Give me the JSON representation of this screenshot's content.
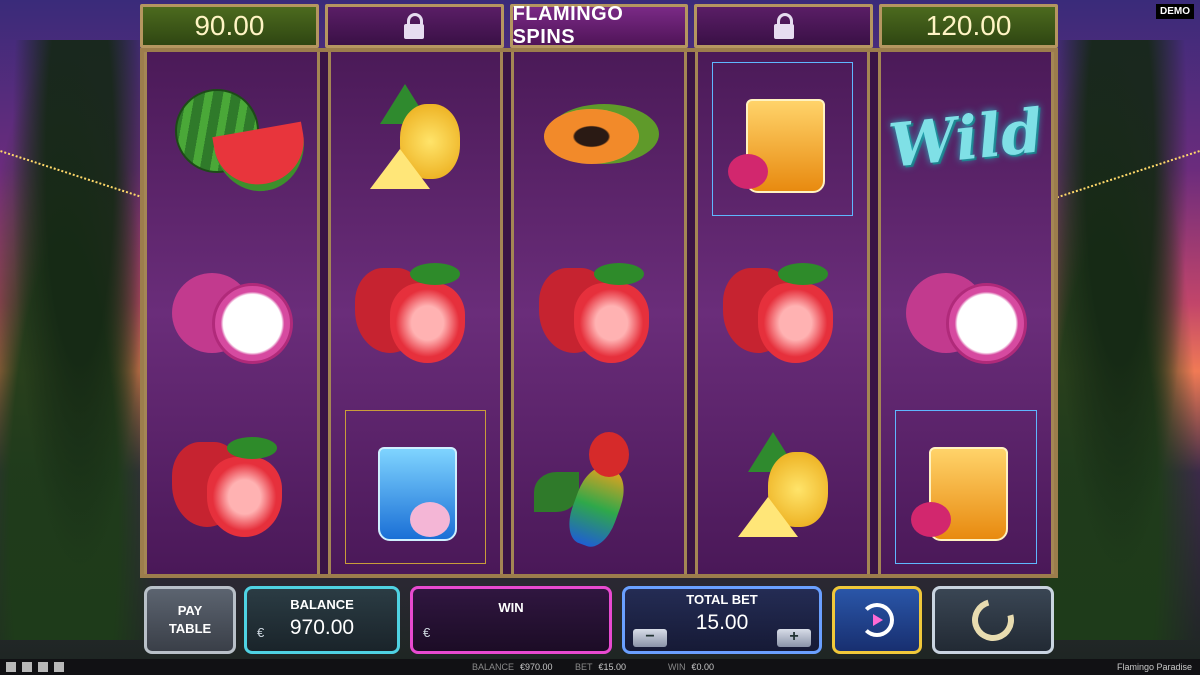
{
  "top_bar": {
    "left_value": "90.00",
    "title": "FLAMINGO SPINS",
    "right_value": "120.00",
    "lock_icons": [
      "lock-icon",
      "lock-icon"
    ]
  },
  "demo_badge": "DEMO",
  "reels": {
    "wild_text": "Wild",
    "symbols": [
      [
        "watermelon",
        "dragonfruit",
        "strawberry"
      ],
      [
        "pineapple",
        "strawberry",
        "blue-cocktail"
      ],
      [
        "papaya",
        "strawberry",
        "parrot"
      ],
      [
        "orange-cocktail",
        "strawberry",
        "pineapple"
      ],
      [
        "wild",
        "dragonfruit",
        "orange-cocktail"
      ]
    ]
  },
  "controls": {
    "pay_table_line1": "PAY",
    "pay_table_line2": "TABLE",
    "balance_label": "BALANCE",
    "balance_value": "970.00",
    "win_label": "WIN",
    "currency": "€",
    "total_bet_label": "TOTAL BET",
    "total_bet_value": "15.00",
    "minus": "−",
    "plus": "+"
  },
  "status_bar": {
    "balance_label": "BALANCE",
    "balance_value": "€970.00",
    "bet_label": "BET",
    "bet_value": "€15.00",
    "win_label": "WIN",
    "win_value": "€0.00",
    "game_title": "Flamingo Paradise"
  },
  "colors": {
    "accent_gold": "#b59660",
    "balance_border": "#4fd2e2",
    "win_border": "#e84ad0",
    "bet_border": "#6aa0ff",
    "autoplay_border": "#f0c83a"
  }
}
